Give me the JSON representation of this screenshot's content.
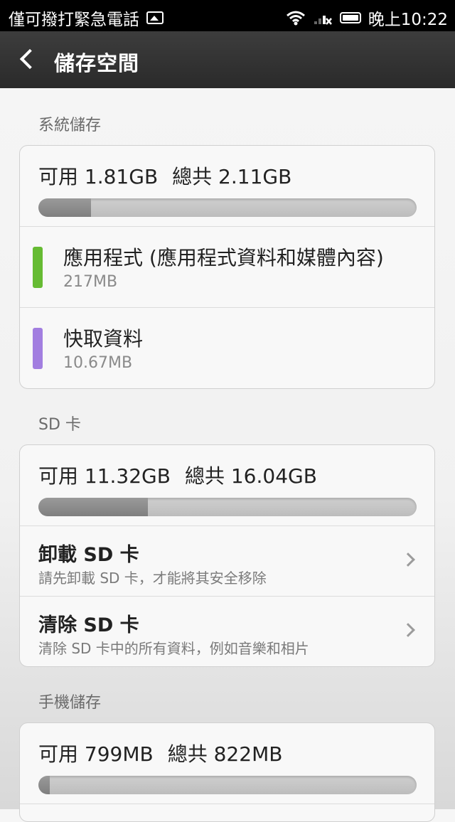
{
  "status_bar": {
    "carrier_text": "僅可撥打緊急電話",
    "time": "晚上10:22"
  },
  "title_bar": {
    "title": "儲存空間"
  },
  "sections": {
    "system": {
      "label": "系統儲存",
      "available": "可用 1.81GB",
      "total": "總共 2.11GB",
      "used_fraction": 0.14,
      "items": [
        {
          "name": "應用程式 (應用程式資料和媒體內容)",
          "size": "217MB",
          "color": "#66bb33"
        },
        {
          "name": "快取資料",
          "size": "10.67MB",
          "color": "#a27ee0"
        }
      ]
    },
    "sd": {
      "label": "SD 卡",
      "available": "可用 11.32GB",
      "total": "總共 16.04GB",
      "used_fraction": 0.29,
      "actions": [
        {
          "name": "卸載 SD 卡",
          "desc": "請先卸載 SD 卡，才能將其安全移除"
        },
        {
          "name": "清除 SD 卡",
          "desc": "清除 SD 卡中的所有資料，例如音樂和相片"
        }
      ]
    },
    "phone": {
      "label": "手機儲存",
      "available": "可用 799MB",
      "total": "總共 822MB",
      "used_fraction": 0.03
    }
  },
  "icons": {
    "back": "chevron-left-icon",
    "wifi": "wifi-icon",
    "signal": "signal-icon",
    "battery": "battery-icon",
    "image": "image-icon",
    "chevron": "chevron-right-icon"
  }
}
